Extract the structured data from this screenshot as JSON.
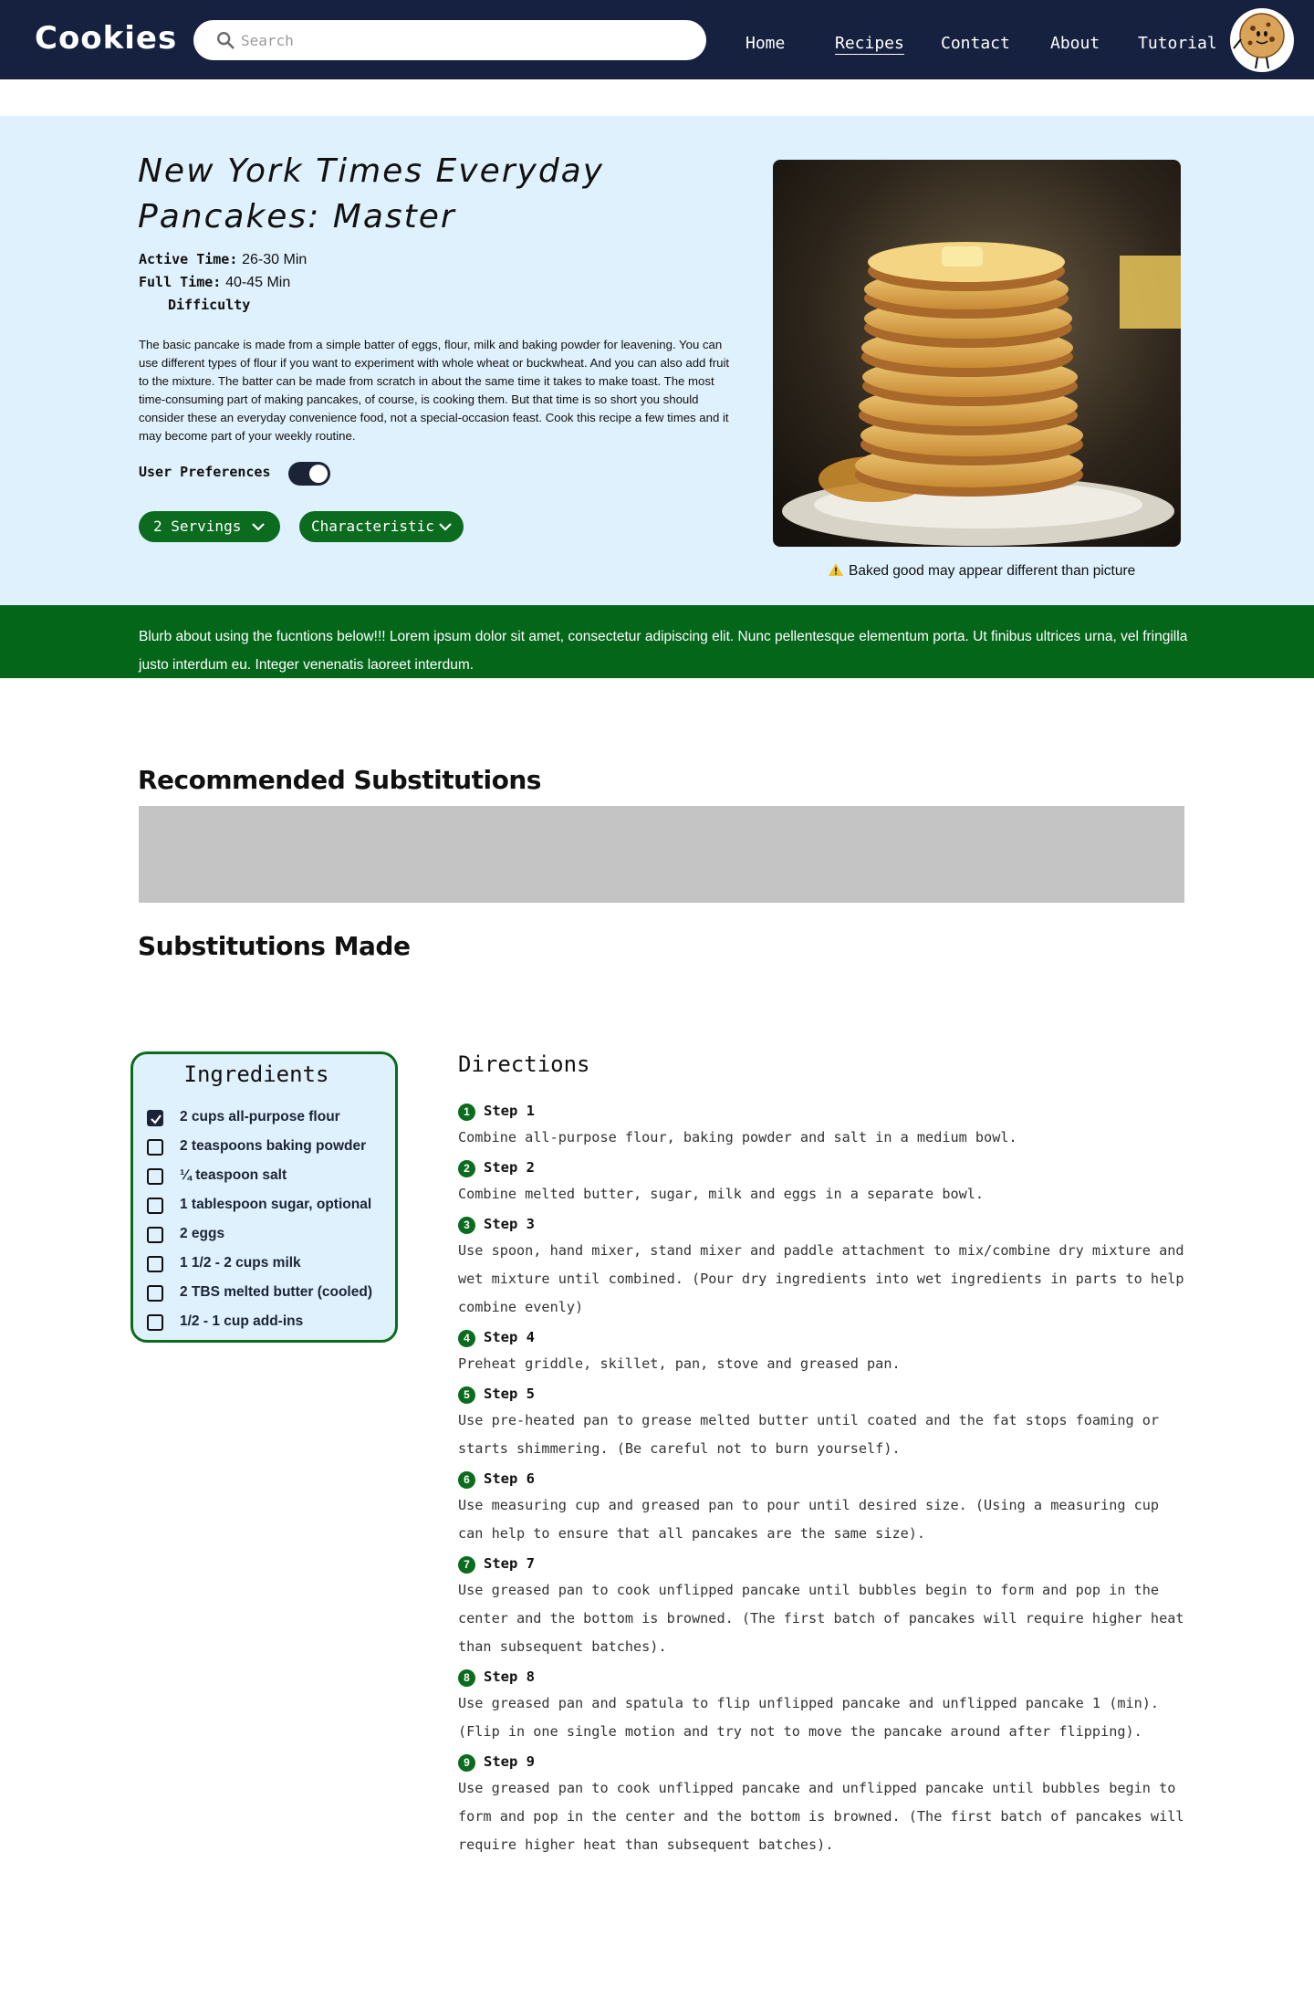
{
  "nav": {
    "logo": "Cookies",
    "search_placeholder": "Search",
    "links": [
      {
        "label": "Home",
        "active": false
      },
      {
        "label": "Recipes",
        "active": true
      },
      {
        "label": "Contact",
        "active": false
      },
      {
        "label": "About",
        "active": false
      },
      {
        "label": "Tutorial",
        "active": false
      }
    ]
  },
  "recipe": {
    "title": "New York Times Everyday Pancakes: Master",
    "active_time_label": "Active Time:",
    "active_time_value": "26-30 Min",
    "full_time_label": "Full Time:",
    "full_time_value": "40-45 Min",
    "difficulty_label": "Difficulty",
    "description": "The basic pancake is made from a simple batter of eggs, flour, milk and baking powder for leavening. You can use different types of flour if you want to experiment with whole wheat or buckwheat. And you can also add fruit to the mixture. The batter can be made from scratch in about the same time it takes to make toast. The most time-consuming part of making pancakes, of course, is cooking them. But that time is so short you should consider these an everyday convenience food, not a special-occasion feast. Cook this recipe a few times and it may become part of your weekly routine.",
    "preferences_label": "User Preferences",
    "preferences_on": true,
    "servings_label": "2 Servings",
    "characteristic_label": "Characteristic",
    "image_caption": "Baked good may appear different than picture"
  },
  "blurb": "Blurb about using the fucntions below!!! Lorem ipsum dolor sit amet, consectetur adipiscing elit. Nunc pellentesque elementum porta. Ut finibus ultrices urna, vel fringilla justo interdum eu. Integer venenatis laoreet interdum.",
  "substitutions": {
    "recommended_heading": "Recommended Substitutions",
    "made_heading": "Substitutions Made"
  },
  "ingredients": {
    "title": "Ingredients",
    "items": [
      {
        "text": "2  cups all-purpose flour",
        "checked": true
      },
      {
        "text": "2 teaspoons baking powder",
        "checked": false
      },
      {
        "text": "¼  teaspoon salt",
        "checked": false
      },
      {
        "text": "1  tablespoon sugar, optional",
        "checked": false
      },
      {
        "text": "2  eggs",
        "checked": false
      },
      {
        "text": "1 1/2 - 2 cups milk",
        "checked": false
      },
      {
        "text": "2  TBS melted butter (cooled)",
        "checked": false
      },
      {
        "text": "1/2 - 1 cup add-ins",
        "checked": false
      }
    ]
  },
  "directions": {
    "title": "Directions",
    "steps": [
      {
        "num": "1",
        "label": "Step 1",
        "text": "Combine all-purpose flour, baking powder and salt in a medium bowl."
      },
      {
        "num": "2",
        "label": "Step 2",
        "text": "Combine melted butter, sugar, milk and eggs in a separate bowl."
      },
      {
        "num": "3",
        "label": "Step 3",
        "text": "Use spoon, hand mixer, stand mixer and paddle attachment to mix/combine dry mixture and wet mixture until combined. (Pour dry ingredients into wet ingredients in parts to help combine evenly)"
      },
      {
        "num": "4",
        "label": "Step 4",
        "text": "Preheat griddle, skillet, pan, stove and greased pan."
      },
      {
        "num": "5",
        "label": "Step 5",
        "text": "Use pre-heated pan to grease melted butter until coated and the fat stops foaming or starts shimmering. (Be careful not to burn yourself)."
      },
      {
        "num": "6",
        "label": "Step 6",
        "text": "Use measuring cup and greased pan to pour until desired size. (Using a measuring cup can help to ensure that all pancakes are the same size)."
      },
      {
        "num": "7",
        "label": "Step 7",
        "text": "Use greased pan to cook unflipped pancake until bubbles begin to form and pop in the center and the bottom is browned. (The first batch of pancakes will require higher heat than subsequent batches)."
      },
      {
        "num": "8",
        "label": "Step 8",
        "text": "Use greased pan and spatula to flip unflipped pancake and unflipped pancake 1 (min). (Flip in one single motion and try not to move the pancake around after flipping)."
      },
      {
        "num": "9",
        "label": "Step 9",
        "text": "Use greased pan to cook unflipped pancake and unflipped pancake until bubbles begin to form and pop in the center and the bottom is browned. (The first batch of pancakes will require higher heat than subsequent batches)."
      }
    ]
  },
  "colors": {
    "navbar": "#15213f",
    "hero_bg": "#dff1fd",
    "accent_green": "#0b6b1e",
    "blurb_bg": "#036619",
    "placeholder_gray": "#c4c4c4"
  }
}
